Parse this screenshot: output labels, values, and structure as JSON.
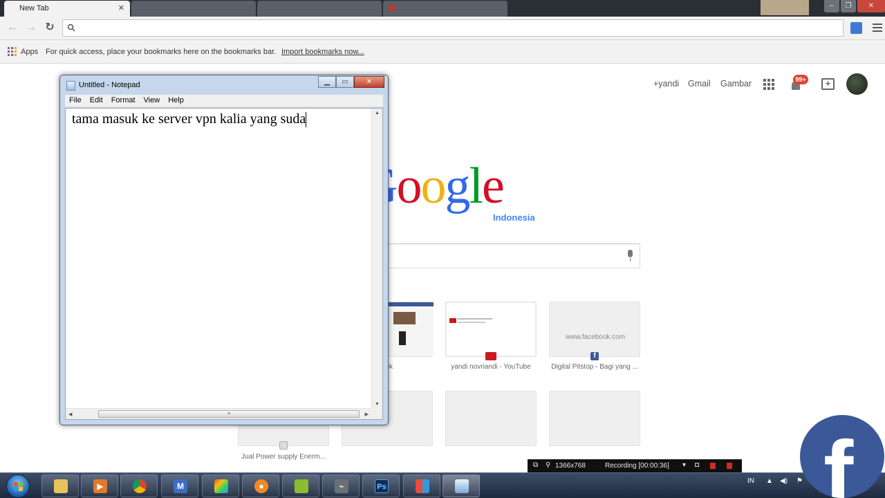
{
  "browser": {
    "tabs": [
      {
        "title": "New Tab",
        "active": true
      },
      {
        "title": "",
        "active": false
      },
      {
        "title": "",
        "active": false
      },
      {
        "title": "",
        "active": false
      }
    ],
    "address_value": "",
    "bookmarks": {
      "apps_label": "Apps",
      "hint": "For quick access, place your bookmarks here on the bookmarks bar.",
      "import_link": "Import bookmarks now..."
    }
  },
  "google": {
    "user_link": "+yandi",
    "gmail_link": "Gmail",
    "images_link": "Gambar",
    "notification_count": "99+",
    "logo_text": "Google",
    "logo_subtitle": "Indonesia",
    "search_value": "",
    "tiles": [
      {
        "label": "ook"
      },
      {
        "label": "yandi novriandi - YouTube"
      },
      {
        "label": "Digital Pitstop - Bagi yang ...",
        "thumb_text": "www.facebook.com"
      },
      {
        "label": "Jual Power supply Enerm..."
      },
      {
        "label": ""
      },
      {
        "label": ""
      },
      {
        "label": ""
      }
    ]
  },
  "notepad": {
    "title": "Untitled - Notepad",
    "menu": [
      "File",
      "Edit",
      "Format",
      "View",
      "Help"
    ],
    "content": "tama masuk ke server vpn kalia yang suda"
  },
  "recorder": {
    "resolution": "1366x768",
    "status": "Recording [00:00:36]"
  },
  "tray": {
    "language": "IN"
  },
  "colors": {
    "google_blue": "#3369e8",
    "google_red": "#d50f25",
    "google_yellow": "#eeb211",
    "google_green": "#009925",
    "facebook_blue": "#3b5998",
    "taskbar": "#1d2a3f"
  }
}
